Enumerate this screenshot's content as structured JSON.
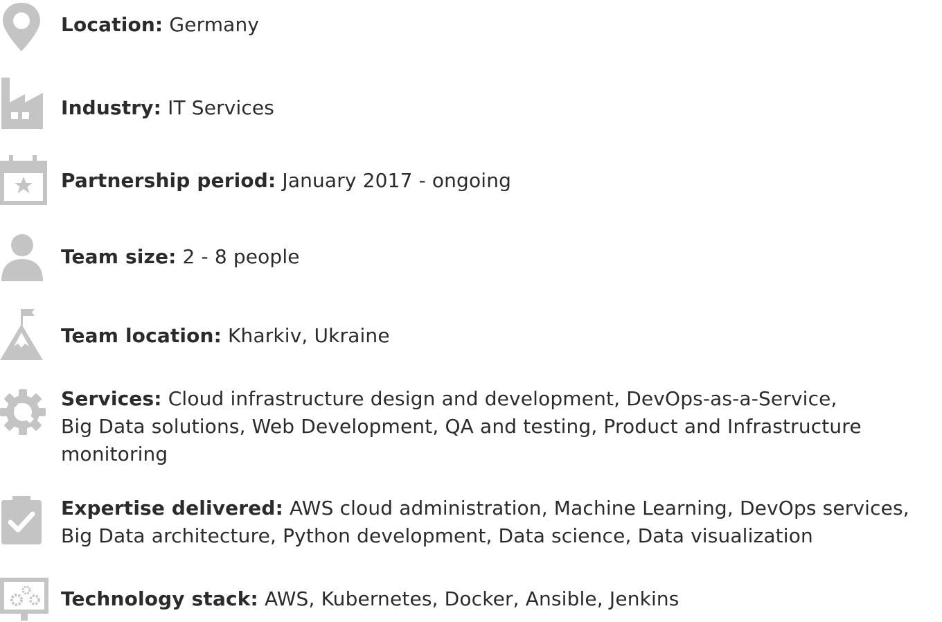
{
  "items": [
    {
      "icon": "location-pin-icon",
      "label": "Location:",
      "value": "Germany"
    },
    {
      "icon": "factory-icon",
      "label": "Industry:",
      "value": "IT Services"
    },
    {
      "icon": "calendar-icon",
      "label": "Partnership period:",
      "value": "January 2017 - ongoing"
    },
    {
      "icon": "person-icon",
      "label": "Team size:",
      "value": "2 - 8 people"
    },
    {
      "icon": "mountain-flag-icon",
      "label": "Team location:",
      "value": "Kharkiv, Ukraine"
    },
    {
      "icon": "gear-wrench-icon",
      "label": "Services:",
      "value": "Cloud infrastructure design and development, DevOps-as-a-Service,\nBig Data solutions, Web Development, QA and testing, Product and Infrastructure\nmonitoring"
    },
    {
      "icon": "clipboard-check-icon",
      "label": "Expertise delivered:",
      "value": "AWS cloud administration, Machine Learning, DevOps services,\nBig Data architecture, Python development, Data science, Data visualization"
    },
    {
      "icon": "monitor-gears-icon",
      "label": "Technology stack:",
      "value": "AWS, Kubernetes, Docker, Ansible, Jenkins"
    }
  ],
  "colors": {
    "icon": "#c4c4c4",
    "text": "#2b2b2b"
  }
}
